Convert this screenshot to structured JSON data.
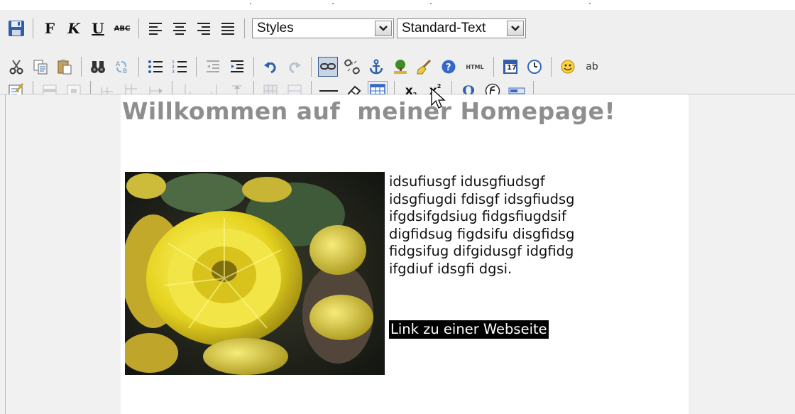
{
  "toolbar": {
    "style_select": "Styles",
    "format_select": "Standard-Text",
    "bold_label": "F",
    "italic_label": "K",
    "underline_label": "U",
    "strike_label": "ABC",
    "html_label": "HTML",
    "date_label": "17",
    "text_label": "ab",
    "omega_label": "Ω",
    "subscript_label": "x",
    "subscript_sub": "2",
    "superscript_label": "x",
    "superscript_sup": "2"
  },
  "document": {
    "heading": "Willkommen auf  meiner Homepage!",
    "paragraph": "idsufiusgf idusgfiudsgf\nidsgfiugdi fdisgf idsgfiudsg\nifgdsifgdsiug fidgsfiugdsif\ndigfidsug figdsifu disgfidsg\nfidgsifug difgidusgf idgfidg\nifgdiuf idsgfi dgsi.",
    "link_text": "Link zu einer Webseite"
  },
  "colors": {
    "heading": "#8e8e8e",
    "toolbar_bg": "#efefef",
    "link_bg": "#000000",
    "active_button_bg": "#c8d4e6"
  }
}
